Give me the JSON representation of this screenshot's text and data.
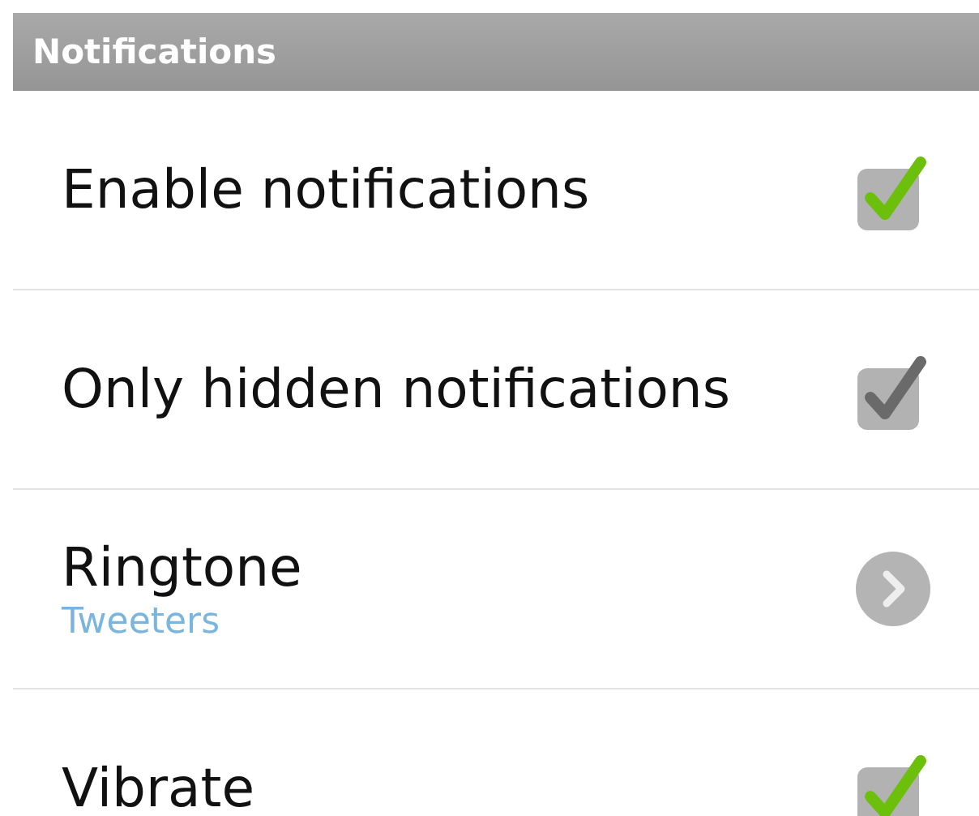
{
  "header": {
    "title": "Notifications"
  },
  "items": [
    {
      "kind": "checkbox",
      "title": "Enable notifications",
      "checked": true,
      "disabled": false
    },
    {
      "kind": "checkbox",
      "title": "Only hidden notifications",
      "checked": true,
      "disabled": true
    },
    {
      "kind": "link",
      "title": "Ringtone",
      "summary": "Tweeters"
    },
    {
      "kind": "checkbox",
      "title": "Vibrate",
      "checked": true,
      "disabled": false
    }
  ]
}
